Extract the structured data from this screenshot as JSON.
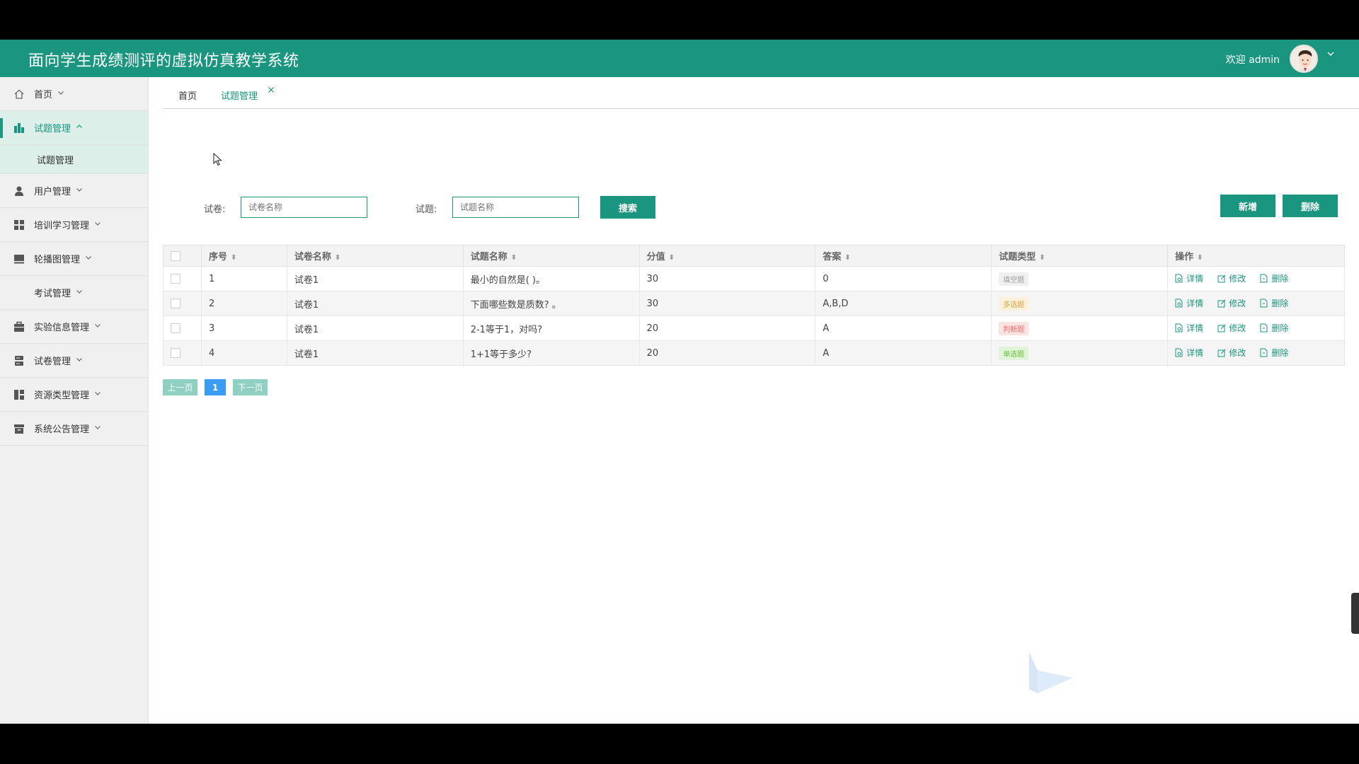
{
  "header": {
    "title": "面向学生成绩测评的虚拟仿真教学系统",
    "welcome": "欢迎 admin"
  },
  "sidebar": {
    "items": [
      {
        "label": "首页",
        "icon": "home-icon"
      },
      {
        "label": "试题管理",
        "icon": "chart-icon",
        "expanded": true,
        "children": [
          {
            "label": "试题管理"
          }
        ]
      },
      {
        "label": "用户管理",
        "icon": "user-icon"
      },
      {
        "label": "培训学习管理",
        "icon": "grid-icon"
      },
      {
        "label": "轮播图管理",
        "icon": "slides-icon"
      },
      {
        "label": "考试管理",
        "icon": ""
      },
      {
        "label": "实验信息管理",
        "icon": "briefcase-icon"
      },
      {
        "label": "试卷管理",
        "icon": "server-icon"
      },
      {
        "label": "资源类型管理",
        "icon": "layout-icon"
      },
      {
        "label": "系统公告管理",
        "icon": "archive-icon"
      }
    ]
  },
  "tabs": [
    {
      "label": "首页"
    },
    {
      "label": "试题管理",
      "active": true
    }
  ],
  "search": {
    "paper_label": "试卷:",
    "paper_placeholder": "试卷名称",
    "question_label": "试题:",
    "question_placeholder": "试题名称",
    "search_button": "搜索",
    "add_button": "新增",
    "delete_button": "删除"
  },
  "table": {
    "headers": [
      "序号",
      "试卷名称",
      "试题名称",
      "分值",
      "答案",
      "试题类型",
      "操作"
    ],
    "rows": [
      {
        "no": "1",
        "paper": "试卷1",
        "question": "最小的自然是( )。",
        "score": "30",
        "answer": "0",
        "type": "填空题"
      },
      {
        "no": "2",
        "paper": "试卷1",
        "question": "下面哪些数是质数? 。",
        "score": "30",
        "answer": "A,B,D",
        "type": "多选题"
      },
      {
        "no": "3",
        "paper": "试卷1",
        "question": "2-1等于1，对吗?",
        "score": "20",
        "answer": "A",
        "type": "判断题"
      },
      {
        "no": "4",
        "paper": "试卷1",
        "question": "1+1等于多少?",
        "score": "20",
        "answer": "A",
        "type": "单选题"
      }
    ],
    "actions": {
      "detail": "详情",
      "edit": "修改",
      "delete": "删除"
    }
  },
  "pagination": {
    "prev": "上一页",
    "current": "1",
    "next": "下一页"
  },
  "colors": {
    "primary": "#1a9680",
    "page_blue": "#3b9cf5",
    "pager_disabled": "#8fd0c3"
  }
}
